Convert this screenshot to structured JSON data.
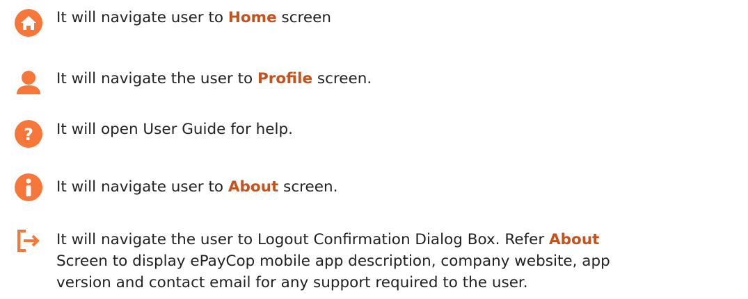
{
  "colors": {
    "accent": "#f7763a",
    "highlight_text": "#c8521c",
    "body_text": "#222222"
  },
  "items": [
    {
      "icon": "home-icon",
      "pre": "It will navigate user to ",
      "highlight": "Home",
      "post": " screen"
    },
    {
      "icon": "profile-icon",
      "pre": "It will navigate the user to ",
      "highlight": "Profile",
      "post": " screen."
    },
    {
      "icon": "help-icon",
      "pre": "It will open User Guide for help.",
      "highlight": "",
      "post": ""
    },
    {
      "icon": "info-icon",
      "pre": "It will navigate user to ",
      "highlight": "About",
      "post": " screen."
    },
    {
      "icon": "logout-icon",
      "pre": "It will navigate the user to Logout Confirmation Dialog Box. Refer ",
      "highlight": "About",
      "line2": "Screen to display ePayCop mobile app description, company website, app",
      "line3": "version and contact email for any support required to the user."
    }
  ]
}
